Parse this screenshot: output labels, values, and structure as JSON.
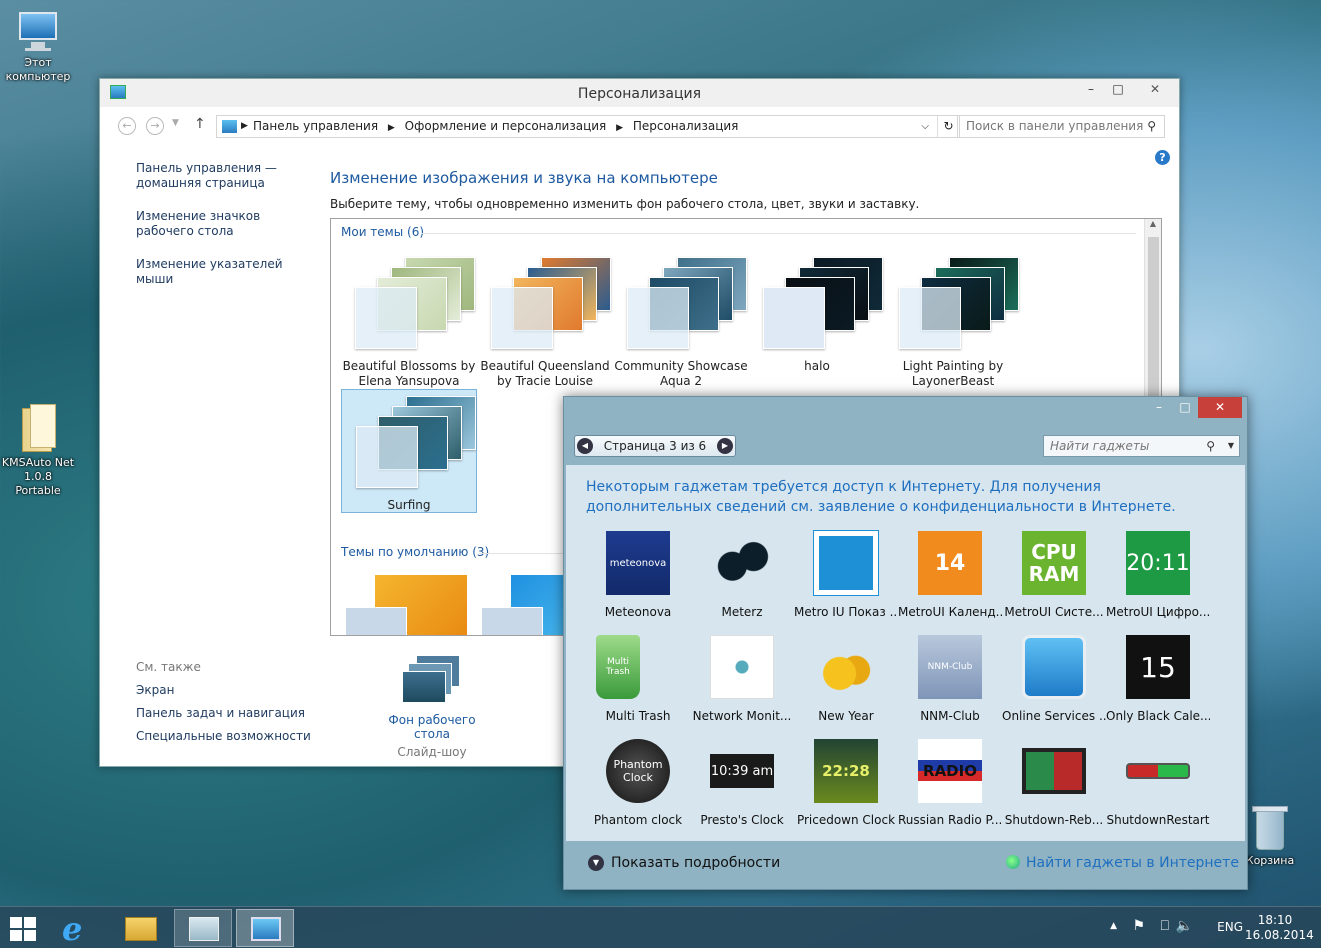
{
  "desktop": {
    "icons": [
      {
        "label": "Этот компьютер"
      },
      {
        "label": "KMSAuto Net 1.0.8 Portable"
      },
      {
        "label": "Корзина"
      }
    ]
  },
  "personalization": {
    "title": "Персонализация",
    "breadcrumb": [
      "Панель управления",
      "Оформление и персонализация",
      "Персонализация"
    ],
    "search_placeholder": "Поиск в панели управления",
    "left_nav": [
      "Панель управления — домашняя страница",
      "Изменение значков рабочего стола",
      "Изменение указателей мыши"
    ],
    "see_also": {
      "heading": "См. также",
      "links": [
        "Экран",
        "Панель задач и навигация",
        "Специальные возможности"
      ]
    },
    "heading": "Изменение изображения и звука на компьютере",
    "subheading": "Выберите тему, чтобы одновременно изменить фон рабочего стола, цвет, звуки и заставку.",
    "my_themes_label": "Мои темы (6)",
    "default_themes_label": "Темы по умолчанию (3)",
    "themes": [
      {
        "name": "Beautiful Blossoms by Elena Yansupova",
        "c": [
          "#c7d8b0",
          "#9fb77d",
          "#e4ecd8",
          "#d8e6c8"
        ]
      },
      {
        "name": "Beautiful Queensland by Tracie Louise",
        "c": [
          "#e07a2e",
          "#2a5c8f",
          "#f2b55c",
          "#f6f6f6"
        ]
      },
      {
        "name": "Community Showcase Aqua 2",
        "c": [
          "#3f6f8a",
          "#7fa8bf",
          "#1e4b66",
          "#dce9f3"
        ]
      },
      {
        "name": "halo",
        "c": [
          "#0b1a24",
          "#102a38",
          "#0a0f14",
          "#3b8fd6"
        ]
      },
      {
        "name": "Light Painting by LayonerBeast",
        "c": [
          "#0a1a18",
          "#1c6e5a",
          "#0e2c40",
          "#9fb8e8"
        ]
      },
      {
        "name": "Surfing",
        "c": [
          "#2b6f8f",
          "#9cc7dc",
          "#2e5e6a",
          "#b9d3e2"
        ]
      }
    ],
    "bottom": {
      "wallpaper_label": "Фон рабочего стола",
      "wallpaper_value": "Слайд-шоу"
    }
  },
  "gadgets": {
    "page_label": "Страница 3 из 6",
    "search_placeholder": "Найти гаджеты",
    "notice": "Некоторым гаджетам требуется доступ к Интернету. Для получения дополнительных сведений см. заявление о конфиденциальности в Интернете.",
    "items": [
      {
        "label": "Meteonova",
        "icon": "meteonova-icon",
        "text": "meteonova"
      },
      {
        "label": "Meterz",
        "icon": "meterz-icon",
        "text": ""
      },
      {
        "label": "Metro IU Показ ...",
        "icon": "photo-icon",
        "text": ""
      },
      {
        "label": "MetroUI Календ...",
        "icon": "calendar-icon",
        "text": "14"
      },
      {
        "label": "MetroUI Систе...",
        "icon": "cpu-ram-icon",
        "text": "CPU RAM"
      },
      {
        "label": "MetroUI Цифро...",
        "icon": "digital-clock-icon",
        "text": "20:11"
      },
      {
        "label": "Multi Trash",
        "icon": "trash-icon",
        "text": "Multi Trash"
      },
      {
        "label": "Network Monit...",
        "icon": "network-icon",
        "text": ""
      },
      {
        "label": "New Year",
        "icon": "bells-icon",
        "text": ""
      },
      {
        "label": "NNM-Club",
        "icon": "nnm-icon",
        "text": "NNM-Club"
      },
      {
        "label": "Online Services ...",
        "icon": "windows-icon",
        "text": ""
      },
      {
        "label": "Only Black Cale...",
        "icon": "black-calendar-icon",
        "text": "15"
      },
      {
        "label": "Phantom clock",
        "icon": "phantom-clock-icon",
        "text": "Phantom Clock"
      },
      {
        "label": "Presto's Clock",
        "icon": "presto-clock-icon",
        "text": "10:39 am"
      },
      {
        "label": "Pricedown Clock",
        "icon": "pricedown-clock-icon",
        "text": "22:28"
      },
      {
        "label": "Russian Radio P...",
        "icon": "radio-icon",
        "text": "RADIO"
      },
      {
        "label": "Shutdown-Reb...",
        "icon": "shutdown-reboot-icon",
        "text": ""
      },
      {
        "label": "ShutdownRestart",
        "icon": "shutdown-restart-icon",
        "text": ""
      }
    ],
    "show_details": "Показать подробности",
    "online_link": "Найти гаджеты в Интернете"
  },
  "taskbar": {
    "lang": "ENG",
    "time": "18:10",
    "date": "16.08.2014"
  }
}
